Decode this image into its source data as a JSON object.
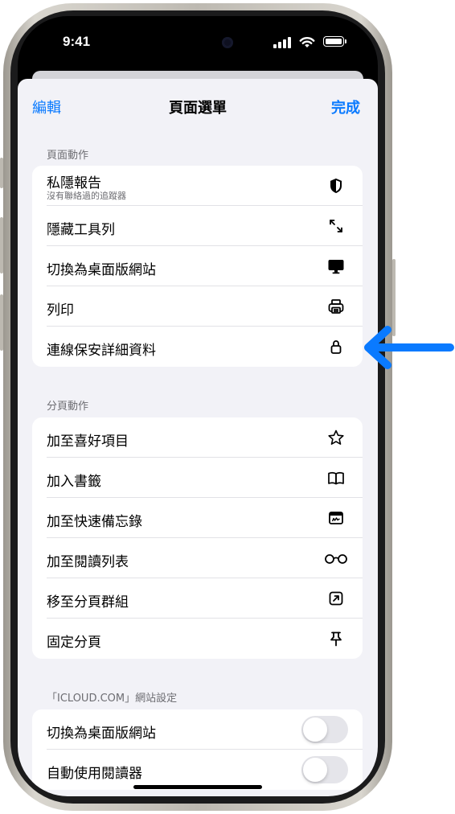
{
  "status": {
    "time": "9:41"
  },
  "nav": {
    "left": "編輯",
    "title": "頁面選單",
    "right": "完成"
  },
  "sections": [
    {
      "header": "頁面動作",
      "rows": [
        {
          "label": "私隱報告",
          "sub": "沒有聯絡過的追蹤器",
          "icon": "shield-icon"
        },
        {
          "label": "隱藏工具列",
          "icon": "resize-arrows-icon"
        },
        {
          "label": "切換為桌面版網站",
          "icon": "desktop-icon"
        },
        {
          "label": "列印",
          "icon": "printer-icon"
        },
        {
          "label": "連線保安詳細資料",
          "icon": "lock-icon"
        }
      ]
    },
    {
      "header": "分頁動作",
      "rows": [
        {
          "label": "加至喜好項目",
          "icon": "star-icon"
        },
        {
          "label": "加入書籤",
          "icon": "book-icon"
        },
        {
          "label": "加至快速備忘錄",
          "icon": "quick-note-icon"
        },
        {
          "label": "加至閱讀列表",
          "icon": "glasses-icon"
        },
        {
          "label": "移至分頁群組",
          "icon": "move-to-group-icon"
        },
        {
          "label": "固定分頁",
          "icon": "pin-icon"
        }
      ]
    },
    {
      "header": "「ICLOUD.COM」網站設定",
      "rows": [
        {
          "label": "切換為桌面版網站",
          "toggle": false
        },
        {
          "label": "自動使用閱讀器",
          "toggle": false
        }
      ]
    }
  ],
  "colors": {
    "accent": "#0a7aff",
    "callout_arrow": "#0a7aff",
    "background": "#f2f2f7"
  }
}
